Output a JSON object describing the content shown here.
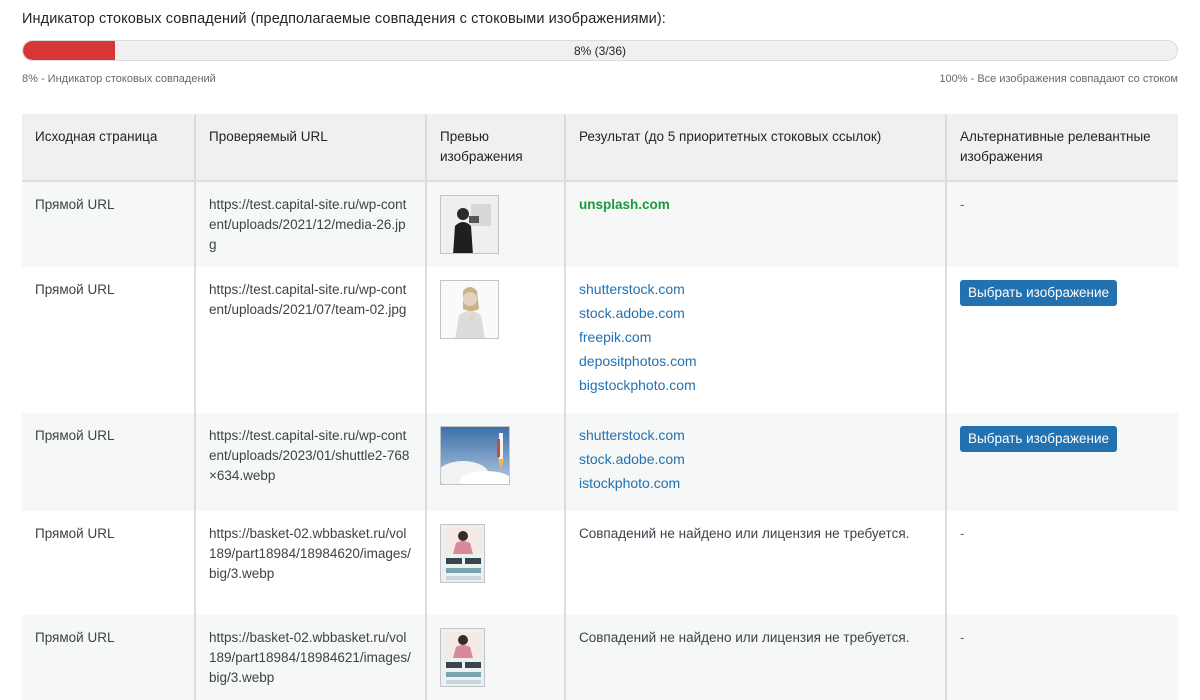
{
  "indicator": {
    "title": "Индикатор стоковых совпадений (предполагаемые совпадения с стоковыми изображениями):",
    "progress_fraction": 0.08,
    "progress_label": "8% (3/36)",
    "scale_left": "8% - Индикатор стоковых совпадений",
    "scale_right": "100% - Все изображения совпадают со стоком",
    "fill_color": "#d63638"
  },
  "table": {
    "headers": {
      "source_page": "Исходная страница",
      "checked_url": "Проверяемый URL",
      "preview": "Превью изображения",
      "result": "Результат (до 5 приоритетных стоковых ссылок)",
      "alternatives": "Альтернативные релевантные изображения"
    },
    "rows": [
      {
        "source": "Прямой URL",
        "url": "https://test.capital-site.ru/wp-content/uploads/2021/12/media-26.jpg",
        "preview_icon": "photo-person-with-camera-icon",
        "result_links": [],
        "result_green": "unsplash.com",
        "result_text": "",
        "alt": "-",
        "alt_button": ""
      },
      {
        "source": "Прямой URL",
        "url": "https://test.capital-site.ru/wp-content/uploads/2021/07/team-02.jpg",
        "preview_icon": "photo-woman-portrait-icon",
        "result_links": [
          "shutterstock.com",
          "stock.adobe.com",
          "freepik.com",
          "depositphotos.com",
          "bigstockphoto.com"
        ],
        "result_green": "",
        "result_text": "",
        "alt": "",
        "alt_button": "Выбрать изображение"
      },
      {
        "source": "Прямой URL",
        "url": "https://test.capital-site.ru/wp-content/uploads/2023/01/shuttle2-768×634.webp",
        "preview_icon": "photo-rocket-launch-icon",
        "result_links": [
          "shutterstock.com",
          "stock.adobe.com",
          "istockphoto.com"
        ],
        "result_green": "",
        "result_text": "",
        "alt": "",
        "alt_button": "Выбрать изображение"
      },
      {
        "source": "Прямой URL",
        "url": "https://basket-02.wbbasket.ru/vol189/part18984/18984620/images/big/3.webp",
        "preview_icon": "photo-product-card-icon",
        "result_links": [],
        "result_green": "",
        "result_text": "Совпадений не найдено или лицензия не требуется.",
        "alt": "-",
        "alt_button": ""
      },
      {
        "source": "Прямой URL",
        "url": "https://basket-02.wbbasket.ru/vol189/part18984/18984621/images/big/3.webp",
        "preview_icon": "photo-product-card-icon",
        "result_links": [],
        "result_green": "",
        "result_text": "Совпадений не найдено или лицензия не требуется.",
        "alt": "-",
        "alt_button": ""
      }
    ]
  },
  "colors": {
    "link": "#2271b1",
    "green_link": "#1a9a3a",
    "button": "#2271b1",
    "header_bg": "#f0f0f1"
  }
}
